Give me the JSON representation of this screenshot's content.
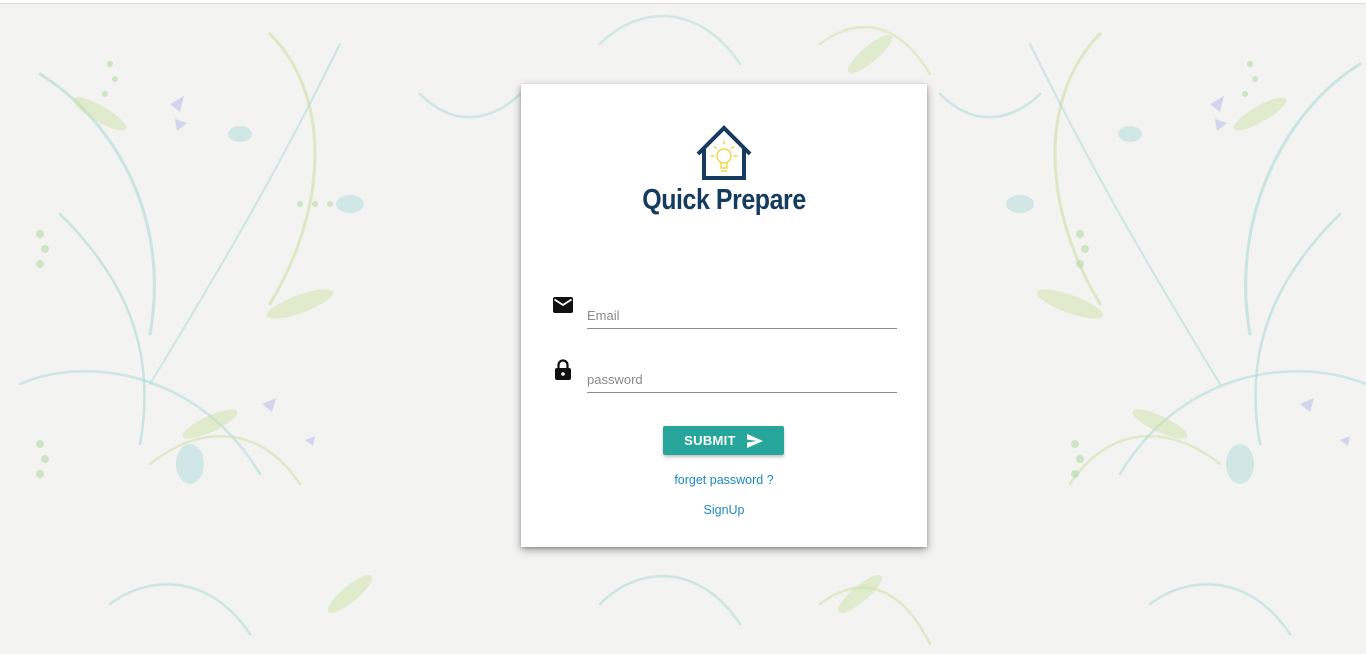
{
  "app": {
    "title": "Quick Prepare"
  },
  "login_form": {
    "email_placeholder": "Email",
    "password_placeholder": "password",
    "submit_label": "SUBMIT",
    "forget_password_label": "forget password ?",
    "signup_label": "SignUp"
  },
  "icons": {
    "logo": "house-lightbulb-icon",
    "email": "envelope-icon",
    "password": "lock-icon",
    "submit": "send-icon"
  },
  "colors": {
    "brand_navy": "#153b5e",
    "button_teal": "#26a69a",
    "link_blue": "#1e88c8",
    "bulb_yellow": "#f3d34a"
  }
}
